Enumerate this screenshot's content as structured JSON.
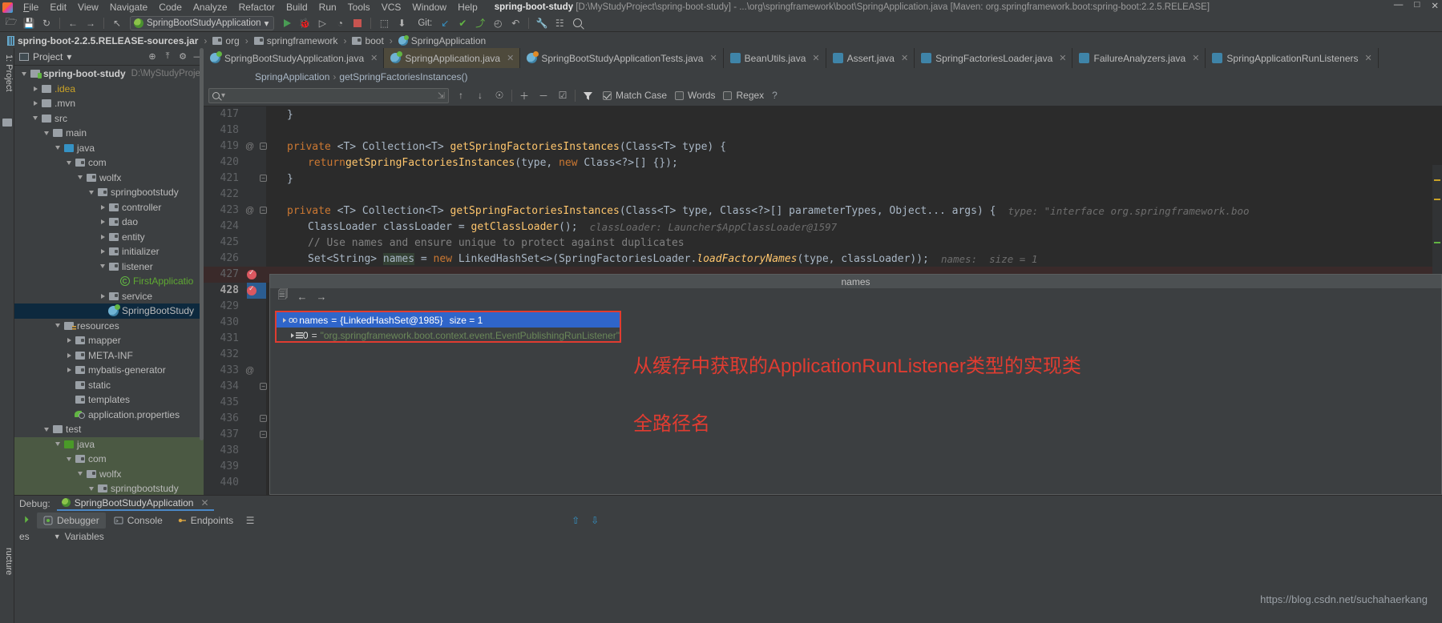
{
  "titlebar": {
    "project_name": "spring-boot-study",
    "project_path": "[D:\\MyStudyProject\\spring-boot-study]",
    "file_part": "- ...\\org\\springframework\\boot\\SpringApplication.java",
    "maven_part": "[Maven: org.springframework.boot:spring-boot:2.2.5.RELEASE]",
    "minimize": "—",
    "maximize": "□",
    "close": "✕"
  },
  "menu": [
    {
      "label": "File"
    },
    {
      "label": "Edit"
    },
    {
      "label": "View"
    },
    {
      "label": "Navigate"
    },
    {
      "label": "Code"
    },
    {
      "label": "Analyze"
    },
    {
      "label": "Refactor"
    },
    {
      "label": "Build"
    },
    {
      "label": "Run"
    },
    {
      "label": "Tools"
    },
    {
      "label": "VCS"
    },
    {
      "label": "Window"
    },
    {
      "label": "Help"
    }
  ],
  "toolbar": {
    "open_icon": "🗁",
    "save_icon": "💾",
    "sync_icon": "↻",
    "back_icon": "←",
    "forward_icon": "→",
    "revert_icon": "↖",
    "run_config": "SpringBootStudyApplication",
    "dropdown_icon": "▾",
    "run_icon": "run-triangle",
    "debug_icon": "🐞",
    "run_coverage_icon": "▷",
    "profile_icon": "◔",
    "stop_icon": "stop-square",
    "build_icon": "⬚",
    "update_icon": "⬇",
    "git_label": "Git:",
    "git_update_icon": "↙",
    "git_commit_icon": "✔",
    "git_push_icon": "⤴",
    "history_icon": "◴",
    "undo_icon": "↶",
    "settings_icon": "🔧",
    "structure_icon": "☷",
    "search_icon": "search-magnifier"
  },
  "navbar": {
    "crumbs": [
      {
        "icon": "jar-icon",
        "label": "spring-boot-2.2.5.RELEASE-sources.jar",
        "bold": true
      },
      {
        "icon": "folder-icon",
        "label": "org",
        "bold": false
      },
      {
        "icon": "folder-icon",
        "label": "springframework",
        "bold": false
      },
      {
        "icon": "folder-icon",
        "label": "boot",
        "bold": false
      },
      {
        "icon": "class-icon",
        "label": "SpringApplication",
        "bold": false
      }
    ],
    "separator": "›"
  },
  "left_rail": {
    "top_label": "1: Project",
    "bottom_label": "ructure"
  },
  "project_panel": {
    "title": "Project",
    "dropdown_icon": "▾",
    "tools": [
      "⊕",
      "⤒",
      "⚙",
      "—"
    ],
    "tree": [
      {
        "depth": 0,
        "twisty": "down",
        "icon": "folder-module",
        "label": "spring-boot-study",
        "bold": true,
        "path": "D:\\MyStudyProject",
        "state": "normal"
      },
      {
        "depth": 1,
        "twisty": "right",
        "icon": "folder-plain",
        "label": ".idea",
        "color": "yellow",
        "state": "normal"
      },
      {
        "depth": 1,
        "twisty": "right",
        "icon": "folder-plain",
        "label": ".mvn",
        "state": "normal"
      },
      {
        "depth": 1,
        "twisty": "down",
        "icon": "folder-plain",
        "label": "src",
        "state": "normal"
      },
      {
        "depth": 2,
        "twisty": "down",
        "icon": "folder-plain",
        "label": "main",
        "state": "normal"
      },
      {
        "depth": 3,
        "twisty": "down",
        "icon": "folder-blue",
        "label": "java",
        "state": "normal"
      },
      {
        "depth": 4,
        "twisty": "down",
        "icon": "folder-pkg",
        "label": "com",
        "state": "normal"
      },
      {
        "depth": 5,
        "twisty": "down",
        "icon": "folder-pkg",
        "label": "wolfx",
        "state": "normal"
      },
      {
        "depth": 6,
        "twisty": "down",
        "icon": "folder-pkg",
        "label": "springbootstudy",
        "state": "normal"
      },
      {
        "depth": 7,
        "twisty": "right",
        "icon": "folder-pkg",
        "label": "controller",
        "state": "normal"
      },
      {
        "depth": 7,
        "twisty": "right",
        "icon": "folder-pkg",
        "label": "dao",
        "state": "normal"
      },
      {
        "depth": 7,
        "twisty": "right",
        "icon": "folder-pkg",
        "label": "entity",
        "state": "normal"
      },
      {
        "depth": 7,
        "twisty": "right",
        "icon": "folder-pkg",
        "label": "initializer",
        "state": "normal"
      },
      {
        "depth": 7,
        "twisty": "down",
        "icon": "folder-pkg",
        "label": "listener",
        "state": "normal"
      },
      {
        "depth": 8,
        "twisty": "none",
        "icon": "class-green",
        "label": "FirstApplicatio",
        "color": "green",
        "state": "normal"
      },
      {
        "depth": 7,
        "twisty": "right",
        "icon": "folder-pkg",
        "label": "service",
        "state": "normal"
      },
      {
        "depth": 7,
        "twisty": "none",
        "icon": "spring-class",
        "label": "SpringBootStudy",
        "state": "selected"
      },
      {
        "depth": 3,
        "twisty": "down",
        "icon": "folder-resources",
        "label": "resources",
        "state": "normal"
      },
      {
        "depth": 4,
        "twisty": "right",
        "icon": "folder-pkg",
        "label": "mapper",
        "state": "normal"
      },
      {
        "depth": 4,
        "twisty": "right",
        "icon": "folder-pkg",
        "label": "META-INF",
        "state": "normal"
      },
      {
        "depth": 4,
        "twisty": "right",
        "icon": "folder-pkg",
        "label": "mybatis-generator",
        "state": "normal"
      },
      {
        "depth": 4,
        "twisty": "none",
        "icon": "folder-pkg",
        "label": "static",
        "state": "normal"
      },
      {
        "depth": 4,
        "twisty": "none",
        "icon": "folder-pkg",
        "label": "templates",
        "state": "normal"
      },
      {
        "depth": 4,
        "twisty": "none",
        "icon": "properties-leaf",
        "label": "application.properties",
        "state": "normal"
      },
      {
        "depth": 2,
        "twisty": "down",
        "icon": "folder-plain",
        "label": "test",
        "state": "normal"
      },
      {
        "depth": 3,
        "twisty": "down",
        "icon": "folder-green",
        "label": "java",
        "state": "green"
      },
      {
        "depth": 4,
        "twisty": "down",
        "icon": "folder-pkg",
        "label": "com",
        "state": "green"
      },
      {
        "depth": 5,
        "twisty": "down",
        "icon": "folder-pkg",
        "label": "wolfx",
        "state": "green"
      },
      {
        "depth": 6,
        "twisty": "down",
        "icon": "folder-pkg",
        "label": "springbootstudy",
        "state": "green"
      }
    ]
  },
  "editor": {
    "tabs": [
      {
        "label": "SpringBootStudyApplication.java",
        "icon": "spring-class-icon",
        "active": false,
        "close": "✕"
      },
      {
        "label": "SpringApplication.java",
        "icon": "spring-class-icon",
        "active": true,
        "close": "✕"
      },
      {
        "label": "SpringBootStudyApplicationTests.java",
        "icon": "test-class-icon",
        "active": false,
        "close": "✕"
      },
      {
        "label": "BeanUtils.java",
        "icon": "class-icon",
        "active": false,
        "close": "✕"
      },
      {
        "label": "Assert.java",
        "icon": "class-icon",
        "active": false,
        "close": "✕"
      },
      {
        "label": "SpringFactoriesLoader.java",
        "icon": "class-icon",
        "active": false,
        "close": "✕"
      },
      {
        "label": "FailureAnalyzers.java",
        "icon": "class-icon",
        "active": false,
        "close": "✕"
      },
      {
        "label": "SpringApplicationRunListeners",
        "icon": "class-icon",
        "active": false,
        "close": "✕"
      }
    ],
    "breadcrumb": {
      "class": "SpringApplication",
      "separator": "›",
      "method": "getSpringFactoriesInstances()"
    },
    "findbar": {
      "value": "",
      "placeholder": "",
      "search_icon": "search-magnifier-icon",
      "dropdown_icon": "▾",
      "prev_icon": "↑",
      "next_icon": "↓",
      "select_all_icon": "☉",
      "add_icon": "＋",
      "remove_icon": "－",
      "check_icon": "☑",
      "filter_icon": "filter-funnel-icon",
      "match_case": {
        "label": "Match Case",
        "checked": true
      },
      "words": {
        "label": "Words",
        "checked": false
      },
      "regex": {
        "label": "Regex",
        "checked": false
      },
      "help_icon": "?"
    },
    "first_line": 417,
    "lines": [
      {
        "no": 417,
        "at": false,
        "fold": "",
        "text": "}",
        "indent": 1
      },
      {
        "no": 418,
        "at": false,
        "fold": "",
        "text": "",
        "indent": 0
      },
      {
        "no": 419,
        "at": true,
        "fold": "minus",
        "text": "private <T> Collection<T> getSpringFactoriesInstances(Class<T> type) {",
        "indent": 1
      },
      {
        "no": 420,
        "at": false,
        "fold": "",
        "text": "return getSpringFactoriesInstances(type, new Class<?>[] {});",
        "indent": 2
      },
      {
        "no": 421,
        "at": false,
        "fold": "end",
        "text": "}",
        "indent": 1
      },
      {
        "no": 422,
        "at": false,
        "fold": "",
        "text": "",
        "indent": 0
      },
      {
        "no": 423,
        "at": true,
        "fold": "minus",
        "text": "private <T> Collection<T> getSpringFactoriesInstances(Class<T> type, Class<?>[] parameterTypes, Object... args) {",
        "indent": 1,
        "hint": "type: \"interface org.springframework.boo"
      },
      {
        "no": 424,
        "at": false,
        "fold": "",
        "text": "ClassLoader classLoader = getClassLoader();",
        "indent": 2,
        "hint": "classLoader: Launcher$AppClassLoader@1597"
      },
      {
        "no": 425,
        "at": false,
        "fold": "",
        "text": "// Use names and ensure unique to protect against duplicates",
        "indent": 2,
        "comment": true
      },
      {
        "no": 426,
        "at": false,
        "fold": "",
        "text": "Set<String> names = new LinkedHashSet<>(SpringFactoriesLoader.loadFactoryNames(type, classLoader));",
        "indent": 2,
        "hint": "names:  size = 1"
      },
      {
        "no": 427,
        "at": false,
        "fold": "",
        "breakpoint": true,
        "text": "",
        "indent": 2
      },
      {
        "no": 428,
        "at": false,
        "fold": "",
        "breakpoint": true,
        "current": true,
        "text": "",
        "indent": 2
      },
      {
        "no": 429,
        "at": false,
        "fold": "",
        "text": "",
        "indent": 0
      },
      {
        "no": 430,
        "at": false,
        "fold": "",
        "text": "",
        "indent": 0
      },
      {
        "no": 431,
        "at": false,
        "fold": "",
        "text": "",
        "indent": 0
      },
      {
        "no": 432,
        "at": false,
        "fold": "",
        "text": "",
        "indent": 0
      },
      {
        "no": 433,
        "at": true,
        "fold": "",
        "text": "",
        "indent": 0
      },
      {
        "no": 434,
        "at": false,
        "fold": "end",
        "text": "",
        "indent": 0
      },
      {
        "no": 435,
        "at": false,
        "fold": "",
        "text": "",
        "indent": 0
      },
      {
        "no": 436,
        "at": false,
        "fold": "end",
        "text": "",
        "indent": 0
      },
      {
        "no": 437,
        "at": false,
        "fold": "end",
        "text": "",
        "indent": 0
      },
      {
        "no": 438,
        "at": false,
        "fold": "",
        "text": "",
        "indent": 0
      },
      {
        "no": 439,
        "at": false,
        "fold": "",
        "text": "",
        "indent": 0
      },
      {
        "no": 440,
        "at": false,
        "fold": "",
        "text": "",
        "indent": 0
      }
    ]
  },
  "popup": {
    "title": "names",
    "toolbar": {
      "copy_icon": "🗐",
      "back_icon": "←",
      "forward_icon": "→"
    },
    "rows": [
      {
        "selected": true,
        "twisty": "right",
        "icon": "oo-icon",
        "name": "names",
        "eq": "=",
        "type": "{LinkedHashSet@1985}",
        "size": "size = 1"
      },
      {
        "selected": false,
        "twisty": "right",
        "icon": "list-icon",
        "name": "0",
        "eq": "=",
        "value": "\"org.springframework.boot.context.event.EventPublishingRunListener\""
      }
    ]
  },
  "annotation": {
    "line1": "从缓存中获取的ApplicationRunListener类型的实现类",
    "line2": "全路径名",
    "color": "#e03c31"
  },
  "debug_window": {
    "label": "Debug:",
    "tab": {
      "label": "SpringBootStudyApplication",
      "close": "✕",
      "icon": "spring-run-icon"
    },
    "resume_icon": "resume-program-icon",
    "buttons": [
      {
        "label": "Debugger",
        "icon": "debugger-icon",
        "active": true
      },
      {
        "label": "Console",
        "icon": "console-icon",
        "active": false
      },
      {
        "label": "Endpoints",
        "icon": "endpoints-icon",
        "active": false
      }
    ],
    "extra_icons": [
      "☰",
      "↑",
      "↓"
    ],
    "frames_label": "es",
    "variables_label": "Variables"
  },
  "watermark": "https://blog.csdn.net/suchahaerkang",
  "colors": {
    "bg": "#3c3f41",
    "editor_bg": "#2b2b2b",
    "accent": "#4a88c7",
    "selection": "#0d293e",
    "annotation_red": "#e03c31",
    "active_tab": "#4e4a3c",
    "green_scope": "#4b5943"
  }
}
